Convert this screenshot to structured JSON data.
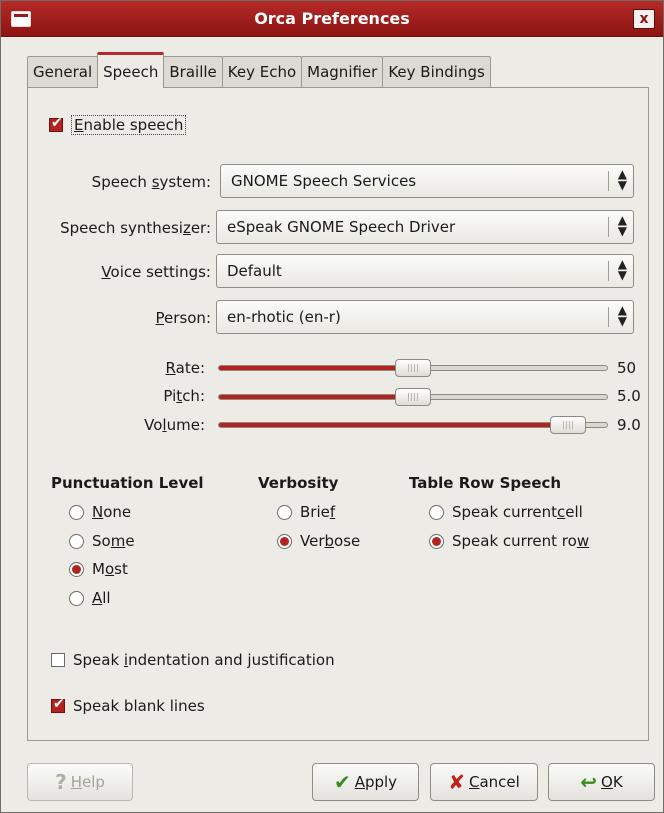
{
  "window": {
    "title": "Orca Preferences",
    "close_glyph": "x"
  },
  "tabs": [
    "General",
    "Speech",
    "Braille",
    "Key Echo",
    "Magnifier",
    "Key Bindings"
  ],
  "enable_speech": {
    "pre": "",
    "u": "E",
    "post": "nable speech",
    "checked": true
  },
  "fields": {
    "speech_system": {
      "pre": "Speech ",
      "u": "s",
      "post": "ystem:",
      "value": "GNOME Speech Services"
    },
    "synthesizer": {
      "pre": "Speech synthesi",
      "u": "z",
      "post": "er:",
      "value": "eSpeak GNOME Speech Driver"
    },
    "voice": {
      "pre": "",
      "u": "V",
      "post": "oice settings:",
      "value": "Default"
    },
    "person": {
      "pre": "",
      "u": "P",
      "post": "erson:",
      "value": "en-rhotic (en-r)"
    }
  },
  "sliders": {
    "rate": {
      "pre": "",
      "u": "R",
      "post": "ate:",
      "value": "50",
      "fraction": 0.5
    },
    "pitch": {
      "pre": "Pi",
      "u": "t",
      "post": "ch:",
      "value": "5.0",
      "fraction": 0.5
    },
    "volume": {
      "pre": "Vo",
      "u": "l",
      "post": "ume:",
      "value": "9.0",
      "fraction": 0.9
    }
  },
  "punctuation": {
    "title": "Punctuation Level",
    "options": [
      {
        "pre": "",
        "u": "N",
        "post": "one",
        "selected": false
      },
      {
        "pre": "So",
        "u": "m",
        "post": "e",
        "selected": false
      },
      {
        "pre": "M",
        "u": "o",
        "post": "st",
        "selected": true
      },
      {
        "pre": "",
        "u": "A",
        "post": "ll",
        "selected": false
      }
    ]
  },
  "verbosity": {
    "title": "Verbosity",
    "options": [
      {
        "pre": "Brie",
        "u": "f",
        "post": "",
        "selected": false
      },
      {
        "pre": "Ver",
        "u": "b",
        "post": "ose",
        "selected": true
      }
    ]
  },
  "table_row": {
    "title": "Table Row Speech",
    "options": [
      {
        "pre": "Speak current ",
        "u": "c",
        "post": "ell",
        "selected": false
      },
      {
        "pre": "Speak current ro",
        "u": "w",
        "post": "",
        "selected": true
      }
    ]
  },
  "speak_indentation": {
    "pre": "Speak ",
    "u": "i",
    "post": "ndentation and justification",
    "checked": false
  },
  "speak_blank": {
    "pre": "Speak blank lines",
    "u": "",
    "post": "",
    "checked": true
  },
  "buttons": {
    "help": {
      "pre": "",
      "u": "H",
      "post": "elp",
      "icon": "?"
    },
    "apply": {
      "pre": "",
      "u": "A",
      "post": "pply",
      "icon": "✔"
    },
    "cancel": {
      "pre": "",
      "u": "C",
      "post": "ancel",
      "icon": "✘"
    },
    "ok": {
      "pre": "",
      "u": "O",
      "post": "K",
      "icon": "↩"
    }
  },
  "colors": {
    "accent": "#b3221f",
    "titlebar": "#a01f1d"
  }
}
